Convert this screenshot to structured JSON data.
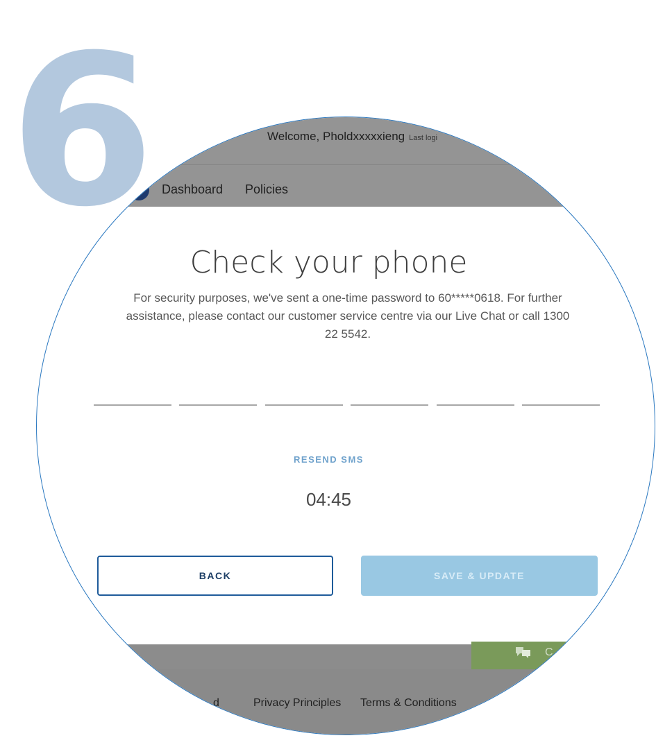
{
  "step": {
    "number": "6"
  },
  "header": {
    "welcome": "Welcome, Pholdxxxxxieng",
    "last_login": "Last logi"
  },
  "nav": {
    "items": [
      "Dashboard",
      "Policies"
    ]
  },
  "modal": {
    "title": "Check your phone",
    "description": "For security purposes, we've sent a one-time password to 60*****0618. For further assistance, please contact our customer service centre via our Live Chat or call 1300 22 5542.",
    "otp_slots": 6,
    "resend_label": "RESEND SMS",
    "timer": "04:45",
    "back_label": "BACK",
    "save_label": "SAVE & UPDATE"
  },
  "chat": {
    "label": "C"
  },
  "footer": {
    "links": [
      "d",
      "Privacy Principles",
      "Terms & Conditions"
    ]
  },
  "colors": {
    "step_number": "#b3c8de",
    "lens_border": "#2a78c0",
    "overlay_gray": "#949494",
    "save_button_disabled": "#99c8e3",
    "back_button_border": "#1e5b9a",
    "resend_link": "#6fa2cc",
    "chat_green": "#7a9a5a"
  }
}
